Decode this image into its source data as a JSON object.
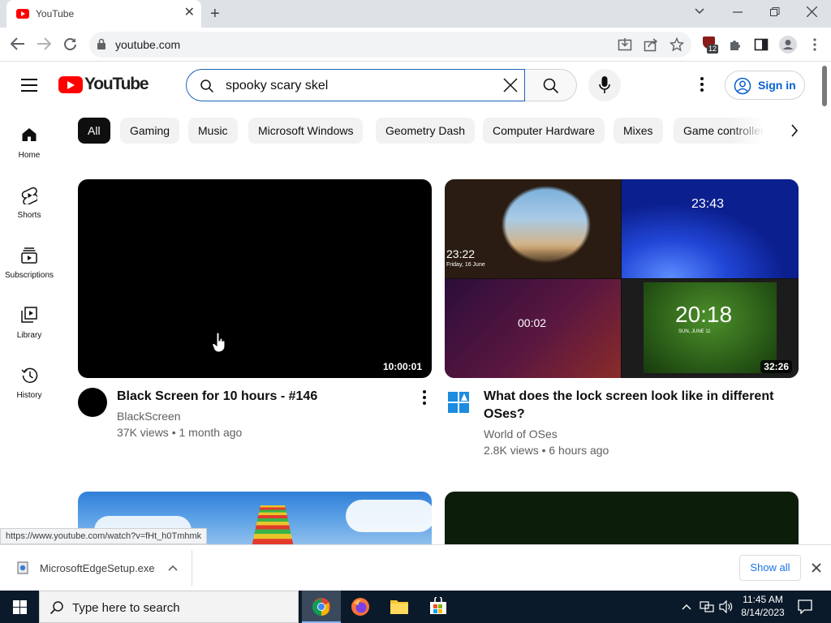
{
  "browser": {
    "tab_title": "YouTube",
    "url": "youtube.com",
    "extension_badge": "12",
    "status_url": "https://www.youtube.com/watch?v=fHt_h0Tmhmk"
  },
  "youtube": {
    "logo_text": "YouTube",
    "search_value": "spooky scary skel",
    "sign_in_label": "Sign in",
    "sidebar": [
      {
        "label": "Home",
        "icon": "home-icon"
      },
      {
        "label": "Shorts",
        "icon": "shorts-icon"
      },
      {
        "label": "Subscriptions",
        "icon": "subscriptions-icon"
      },
      {
        "label": "Library",
        "icon": "library-icon"
      },
      {
        "label": "History",
        "icon": "history-icon"
      }
    ],
    "chips": [
      "All",
      "Gaming",
      "Music",
      "Microsoft Windows",
      "Geometry Dash",
      "Computer Hardware",
      "Mixes",
      "Game controllers"
    ],
    "videos": [
      {
        "title": "Black Screen for 10 hours - #146",
        "channel": "BlackScreen",
        "meta": "37K views • 1 month ago",
        "duration": "10:00:01"
      },
      {
        "title_line1": "What does the lock screen look like in different",
        "title_line2": "OSes?",
        "channel": "World of OSes",
        "meta": "2.8K views • 6 hours ago",
        "duration": "32:26",
        "thumb_texts": {
          "q1_time": "23:22",
          "q1_date": "Friday, 16 June",
          "q2_time": "23:43",
          "q3_time": "00:02",
          "q4_time": "20:18",
          "q4_date": "SUN, JUNE 11"
        }
      }
    ]
  },
  "downloads": {
    "file_name": "MicrosoftEdgeSetup.exe",
    "show_all": "Show all"
  },
  "taskbar": {
    "search_placeholder": "Type here to search",
    "time": "11:45 AM",
    "date": "8/14/2023"
  },
  "colors": {
    "yt_red": "#ff0000",
    "accent_blue": "#065fd4",
    "taskbar": "#0b1a2a"
  }
}
